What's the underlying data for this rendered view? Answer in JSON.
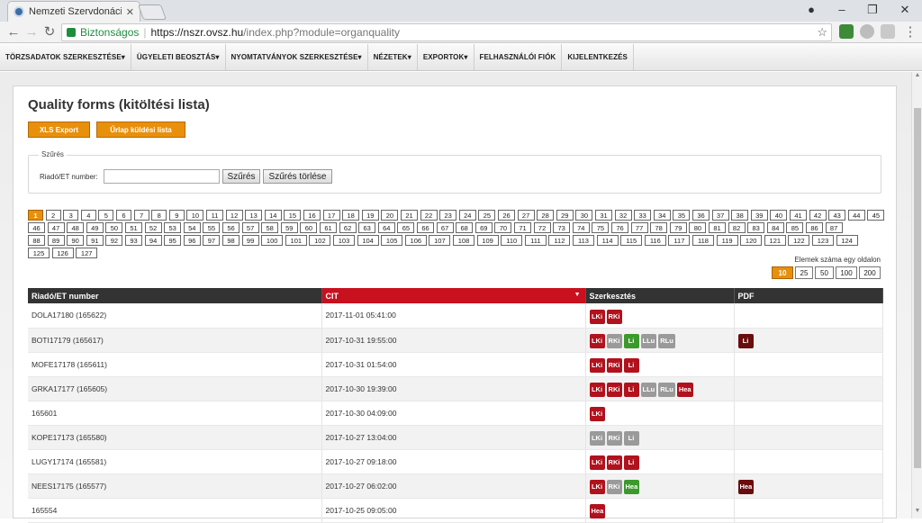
{
  "browser": {
    "tab_title": "Nemzeti Szervdonációs R",
    "secure_label": "Biztonságos",
    "url_scheme_host": "https://nszr.ovsz.hu",
    "url_path": "/index.php?module=organquality"
  },
  "menu": {
    "items": [
      {
        "label": "TÖRZSADATOK SZERKESZTÉSE",
        "dropdown": true
      },
      {
        "label": "ÜGYELETI BEOSZTÁS",
        "dropdown": true
      },
      {
        "label": "NYOMTATVÁNYOK SZERKESZTÉSE",
        "dropdown": true
      },
      {
        "label": "NÉZETEK",
        "dropdown": true
      },
      {
        "label": "EXPORTOK",
        "dropdown": true
      },
      {
        "label": "FELHASZNÁLÓI FIÓK",
        "dropdown": false
      },
      {
        "label": "KIJELENTKEZÉS",
        "dropdown": false
      }
    ]
  },
  "page": {
    "title": "Quality forms (kitöltési lista)",
    "xls_button": "XLS Export",
    "send_list_button": "Űrlap küldési lista"
  },
  "filter": {
    "legend": "Szűrés",
    "label": "Riadó/ET number:",
    "value": "",
    "filter_button": "Szűrés",
    "clear_button": "Szűrés törlése"
  },
  "pagination": {
    "current": 1,
    "total": 127
  },
  "per_page": {
    "label": "Elemek száma egy oldalon",
    "options": [
      "10",
      "25",
      "50",
      "100",
      "200"
    ],
    "selected": "10"
  },
  "table": {
    "headers": [
      "Riadó/ET number",
      "CIT",
      "Szerkesztés",
      "PDF"
    ],
    "sorted_column": "CIT",
    "rows": [
      {
        "id": "DOLA17180 (165622)",
        "cit": "2017-11-01 05:41:00",
        "edit": [
          [
            "LKi",
            "red"
          ],
          [
            "RKi",
            "red"
          ]
        ],
        "pdf": []
      },
      {
        "id": "BOTI17179 (165617)",
        "cit": "2017-10-31 19:55:00",
        "edit": [
          [
            "LKi",
            "red"
          ],
          [
            "RKi",
            "gray"
          ],
          [
            "Li",
            "green"
          ],
          [
            "LLu",
            "gray"
          ],
          [
            "RLu",
            "gray"
          ]
        ],
        "pdf": [
          [
            "Li",
            "dark"
          ]
        ]
      },
      {
        "id": "MOFE17178 (165611)",
        "cit": "2017-10-31 01:54:00",
        "edit": [
          [
            "LKi",
            "red"
          ],
          [
            "RKi",
            "red"
          ],
          [
            "Li",
            "red"
          ]
        ],
        "pdf": []
      },
      {
        "id": "GRKA17177 (165605)",
        "cit": "2017-10-30 19:39:00",
        "edit": [
          [
            "LKi",
            "red"
          ],
          [
            "RKi",
            "red"
          ],
          [
            "Li",
            "red"
          ],
          [
            "LLu",
            "gray"
          ],
          [
            "RLu",
            "gray"
          ],
          [
            "Hea",
            "red"
          ]
        ],
        "pdf": []
      },
      {
        "id": "165601",
        "cit": "2017-10-30 04:09:00",
        "edit": [
          [
            "LKi",
            "red"
          ]
        ],
        "pdf": []
      },
      {
        "id": "KOPE17173 (165580)",
        "cit": "2017-10-27 13:04:00",
        "edit": [
          [
            "LKi",
            "gray"
          ],
          [
            "RKi",
            "gray"
          ],
          [
            "Li",
            "gray"
          ]
        ],
        "pdf": []
      },
      {
        "id": "LUGY17174 (165581)",
        "cit": "2017-10-27 09:18:00",
        "edit": [
          [
            "LKi",
            "red"
          ],
          [
            "RKi",
            "red"
          ],
          [
            "Li",
            "red"
          ]
        ],
        "pdf": []
      },
      {
        "id": "NEES17175 (165577)",
        "cit": "2017-10-27 06:02:00",
        "edit": [
          [
            "LKi",
            "red"
          ],
          [
            "RKi",
            "gray"
          ],
          [
            "Hea",
            "green"
          ]
        ],
        "pdf": [
          [
            "Hea",
            "dark"
          ]
        ]
      },
      {
        "id": "165554",
        "cit": "2017-10-25 09:05:00",
        "edit": [
          [
            "Hea",
            "red"
          ]
        ],
        "pdf": []
      }
    ]
  }
}
